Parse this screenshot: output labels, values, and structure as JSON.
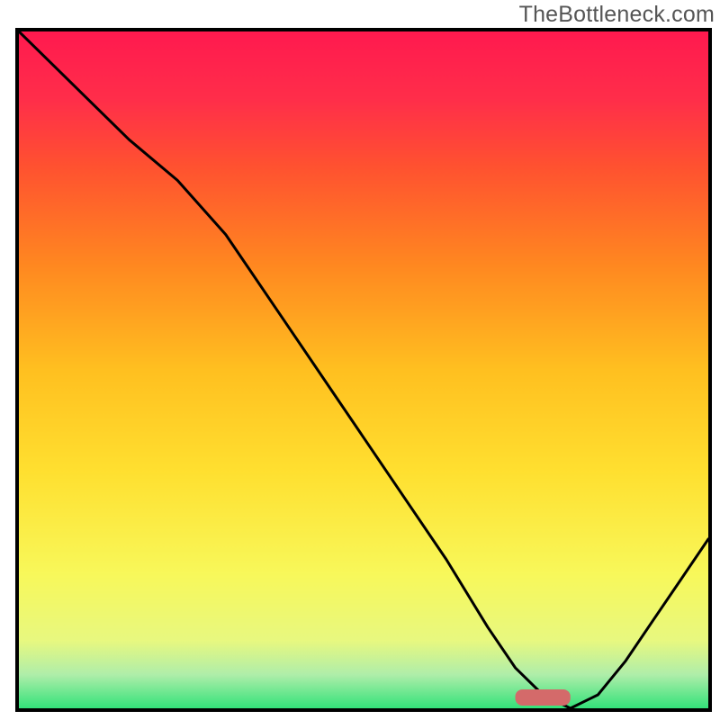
{
  "watermark": "TheBottleneck.com",
  "chart_data": {
    "type": "line",
    "title": "",
    "xlabel": "",
    "ylabel": "",
    "xlim": [
      0,
      100
    ],
    "ylim": [
      0,
      100
    ],
    "legend": false,
    "grid": false,
    "annotations": [],
    "series": [
      {
        "name": "bottleneck-curve",
        "color": "#000000",
        "x": [
          0,
          5,
          10,
          16,
          23,
          30,
          38,
          46,
          54,
          62,
          68,
          72,
          76,
          80,
          84,
          88,
          92,
          96,
          100
        ],
        "values": [
          100,
          95,
          90,
          84,
          78,
          70,
          58,
          46,
          34,
          22,
          12,
          6,
          2,
          0,
          2,
          7,
          13,
          19,
          25
        ]
      }
    ],
    "highlighted_region": {
      "color": "#d46a6a",
      "x_from": 72,
      "x_to": 80,
      "y_from": 0,
      "y_to": 2
    },
    "background_gradient_stops": [
      {
        "pos": 0.0,
        "color": "#ff1a4f"
      },
      {
        "pos": 0.1,
        "color": "#ff2e4a"
      },
      {
        "pos": 0.2,
        "color": "#ff5230"
      },
      {
        "pos": 0.35,
        "color": "#ff8a20"
      },
      {
        "pos": 0.5,
        "color": "#ffc020"
      },
      {
        "pos": 0.65,
        "color": "#ffe030"
      },
      {
        "pos": 0.8,
        "color": "#f8f85a"
      },
      {
        "pos": 0.9,
        "color": "#e8f880"
      },
      {
        "pos": 0.95,
        "color": "#b0eeaa"
      },
      {
        "pos": 1.0,
        "color": "#34e27a"
      }
    ]
  }
}
